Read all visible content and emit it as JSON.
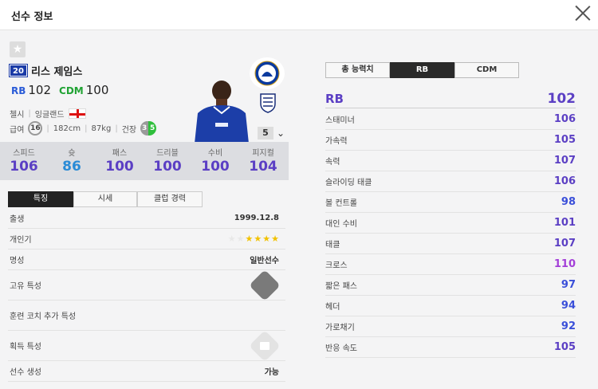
{
  "window": {
    "title": "선수 정보"
  },
  "player": {
    "season_badge": "20",
    "name": "리스 제임스",
    "positions": [
      {
        "pos": "RB",
        "ovr": "102"
      },
      {
        "pos": "CDM",
        "ovr": "100"
      }
    ],
    "club": "첼시",
    "nation": "잉글랜드",
    "salary_label": "급여",
    "salary": "16",
    "height": "182cm",
    "weight": "87kg",
    "build": "건장",
    "skill_left": "3",
    "skill_right": "5",
    "level": "5"
  },
  "stats": [
    {
      "label": "스피드",
      "value": "106"
    },
    {
      "label": "슛",
      "value": "86"
    },
    {
      "label": "패스",
      "value": "100"
    },
    {
      "label": "드리블",
      "value": "100"
    },
    {
      "label": "수비",
      "value": "100"
    },
    {
      "label": "피지컬",
      "value": "104"
    }
  ],
  "left_tabs": [
    "특징",
    "시세",
    "클럽 경력"
  ],
  "traits": {
    "birth_label": "출생",
    "birth": "1999.12.8",
    "popularity_label": "개인기",
    "popularity_stars": 4,
    "popularity_max": 6,
    "fame_label": "명성",
    "fame": "일반선수",
    "unique_label": "고유 특성",
    "coach_label": "훈련 코치 추가 특성",
    "acquired_label": "획득 특성",
    "create_label": "선수 생성",
    "create": "가능"
  },
  "right_tabs": [
    "총 능력치",
    "RB",
    "CDM"
  ],
  "position_stats": {
    "pos": "RB",
    "ovr": "102",
    "rows": [
      {
        "label": "스태미너",
        "value": "106",
        "tone": "purple"
      },
      {
        "label": "가속력",
        "value": "105",
        "tone": "purple"
      },
      {
        "label": "속력",
        "value": "107",
        "tone": "purple"
      },
      {
        "label": "슬라이딩 태클",
        "value": "106",
        "tone": "purple"
      },
      {
        "label": "볼 컨트롤",
        "value": "98",
        "tone": "blue"
      },
      {
        "label": "대인 수비",
        "value": "101",
        "tone": "purple"
      },
      {
        "label": "태클",
        "value": "107",
        "tone": "purple"
      },
      {
        "label": "크로스",
        "value": "110",
        "tone": "pink"
      },
      {
        "label": "짧은 패스",
        "value": "97",
        "tone": "blue"
      },
      {
        "label": "헤더",
        "value": "94",
        "tone": "blue"
      },
      {
        "label": "가로채기",
        "value": "92",
        "tone": "blue"
      },
      {
        "label": "반응 속도",
        "value": "105",
        "tone": "purple"
      }
    ]
  },
  "colors": {
    "accent": "#5b3fc4",
    "shoot": "#2a8bd6",
    "rb": "#2a5bd7",
    "cdm": "#21a334"
  }
}
